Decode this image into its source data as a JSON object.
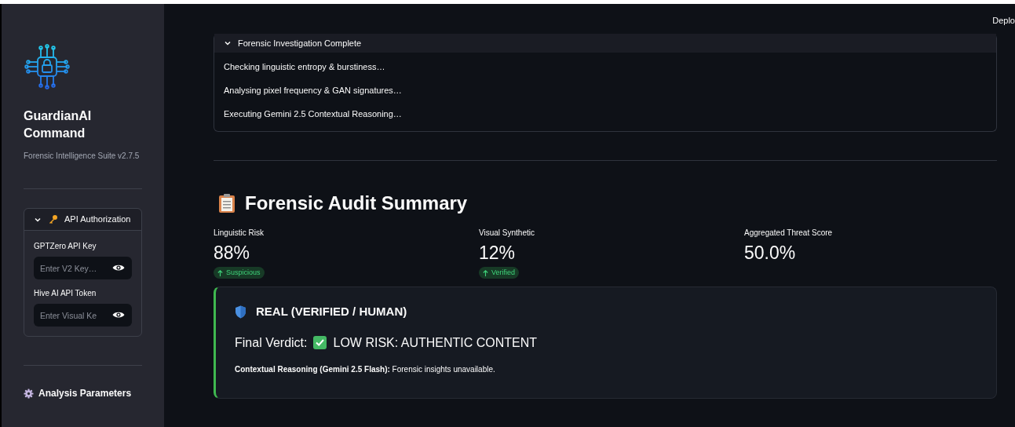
{
  "sidebar": {
    "app_title": "GuardianAI Command",
    "subtitle": "Forensic Intelligence Suite v2.7.5",
    "api_section": {
      "title": "API Authorization",
      "expanded": true,
      "fields": [
        {
          "label": "GPTZero API Key",
          "placeholder": "Enter V2 Key…"
        },
        {
          "label": "Hive AI API Token",
          "placeholder": "Enter Visual Ke"
        }
      ]
    },
    "parameters_heading": "Analysis Parameters"
  },
  "toolbar": {
    "deploy": "Deplo"
  },
  "status_panel": {
    "title": "Forensic Investigation Complete",
    "expanded": true,
    "steps": [
      "Checking linguistic entropy & burstiness…",
      "Analysing pixel frequency & GAN signatures…",
      "Executing Gemini 2.5 Contextual Reasoning…"
    ]
  },
  "summary": {
    "heading": "Forensic Audit Summary",
    "metrics": [
      {
        "label": "Linguistic Risk",
        "value": "88%",
        "delta": "Suspicious"
      },
      {
        "label": "Visual Synthetic",
        "value": "12%",
        "delta": "Verified"
      },
      {
        "label": "Aggregated Threat Score",
        "value": "50.0%"
      }
    ]
  },
  "verdict": {
    "classification": "REAL (VERIFIED / HUMAN)",
    "verdict_label": "Final Verdict:",
    "verdict_text": "LOW RISK: AUTHENTIC CONTENT",
    "reasoning": "**Contextual Reasoning (Gemini 2.5 Flash):** Forensic insights unavailable.",
    "color": "#3fb950"
  }
}
